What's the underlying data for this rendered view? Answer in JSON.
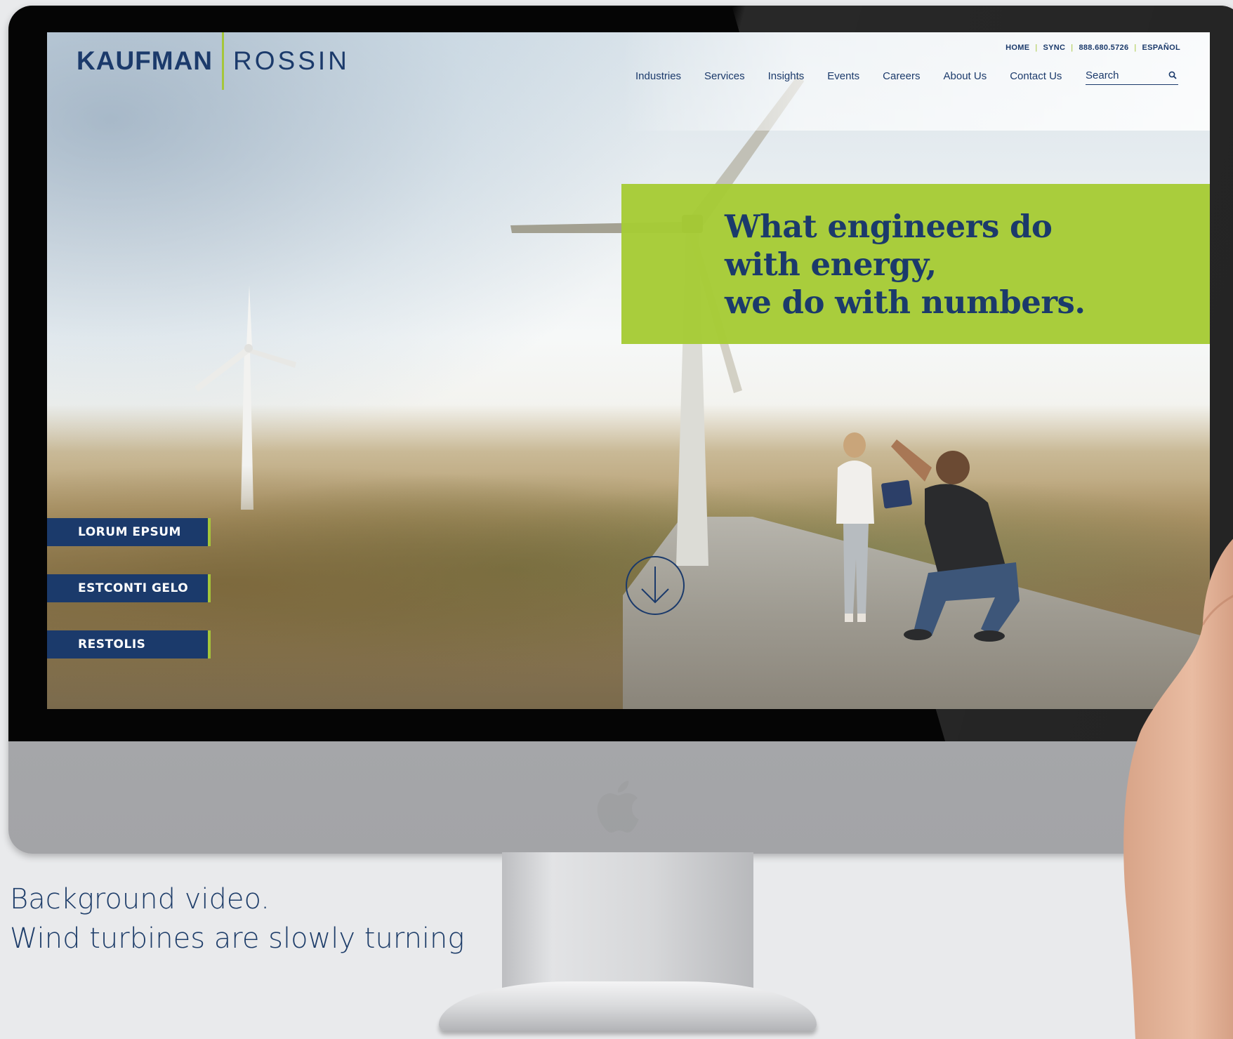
{
  "brand": {
    "name_part1": "KAUFMAN",
    "name_part2": "ROSSIN",
    "colors": {
      "navy": "#1b3a6b",
      "green": "#a6cb36"
    }
  },
  "utility_nav": [
    "HOME",
    "SYNC",
    "888.680.5726",
    "ESPAÑOL"
  ],
  "main_nav": [
    "Industries",
    "Services",
    "Insights",
    "Events",
    "Careers",
    "About Us",
    "Contact Us"
  ],
  "search": {
    "placeholder": "Search",
    "icon": "search-icon"
  },
  "hero": {
    "lines": [
      "What engineers do",
      "with energy,",
      "we do with numbers."
    ]
  },
  "side_buttons": [
    "LORUM EPSUM",
    "ESTCONTI GELO",
    "RESTOLIS"
  ],
  "scroll_icon": "arrow-down-circle-icon",
  "caption": {
    "line1": "Background video.",
    "line2": "Wind turbines are slowly turning"
  }
}
